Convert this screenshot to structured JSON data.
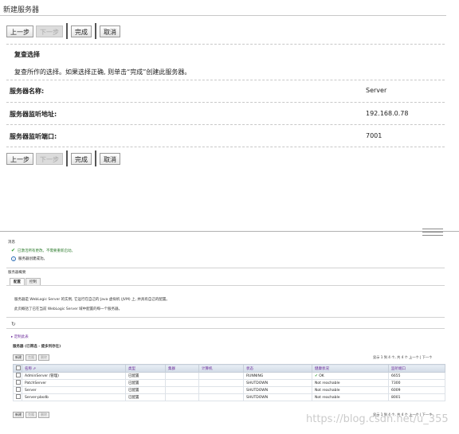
{
  "wizard": {
    "title": "新建服务器",
    "buttons": {
      "back": "上一步",
      "next": "下一步",
      "finish": "完成",
      "cancel": "取消"
    },
    "section_title": "复查选择",
    "instructions": "复查所作的选择。如果选择正确, 则单击“完成”创建此服务器。",
    "fields": [
      {
        "label": "服务器名称:",
        "value": "Server"
      },
      {
        "label": "服务器监听地址:",
        "value": "192.168.0.78"
      },
      {
        "label": "服务器监听端口:",
        "value": "7001"
      }
    ]
  },
  "console": {
    "messages_title": "消息",
    "messages": [
      {
        "icon": "check-icon",
        "text": "已激活所有更改。不需要重新启动。"
      },
      {
        "icon": "info-icon",
        "text": "服务器创建成功。"
      }
    ],
    "summary_title": "服务器概要",
    "tabs": [
      {
        "label": "配置",
        "active": true
      },
      {
        "label": "控制",
        "active": false
      }
    ],
    "description_1": "服务器是 WebLogic Server 的实例, 它运行在自己的 Java 虚拟机 (JVM) 上, 并具有自己的配置。",
    "description_2": "此页概括了已在当前 WebLogic Server 域中配置的每一个服务器。",
    "customize_link": "定制此表",
    "table_title": "服务器 (已筛选 - 提多列存在)",
    "grid_buttons": {
      "new": "新建",
      "clone": "克隆",
      "delete": "删除"
    },
    "pager_top": "显示 1 到 4 个, 共 4 个   上一个 | 下一个",
    "pager_bottom": "显示 1 到 4 个, 共 4 个   上一个 | 下一个",
    "columns": [
      "名称 ⇗",
      "类型",
      "集群",
      "计算机",
      "状态",
      "健康状况",
      "监听端口"
    ],
    "rows": [
      {
        "name": "AdminServer (管理)",
        "type": "已配置",
        "cluster": "",
        "machine": "",
        "state": "RUNNING",
        "health": "OK",
        "health_ok": true,
        "port": "6655"
      },
      {
        "name": "PatchServer",
        "type": "已配置",
        "cluster": "",
        "machine": "",
        "state": "SHUTDOWN",
        "health": "Not reachable",
        "health_ok": false,
        "port": "7300"
      },
      {
        "name": "Server",
        "type": "已配置",
        "cluster": "",
        "machine": "",
        "state": "SHUTDOWN",
        "health": "Not reachable",
        "health_ok": false,
        "port": "6009"
      },
      {
        "name": "Server-pbsdb",
        "type": "已配置",
        "cluster": "",
        "machine": "",
        "state": "SHUTDOWN",
        "health": "Not reachable",
        "health_ok": false,
        "port": "8001"
      }
    ]
  },
  "watermark": "https://blog.csdn.net/u_355"
}
